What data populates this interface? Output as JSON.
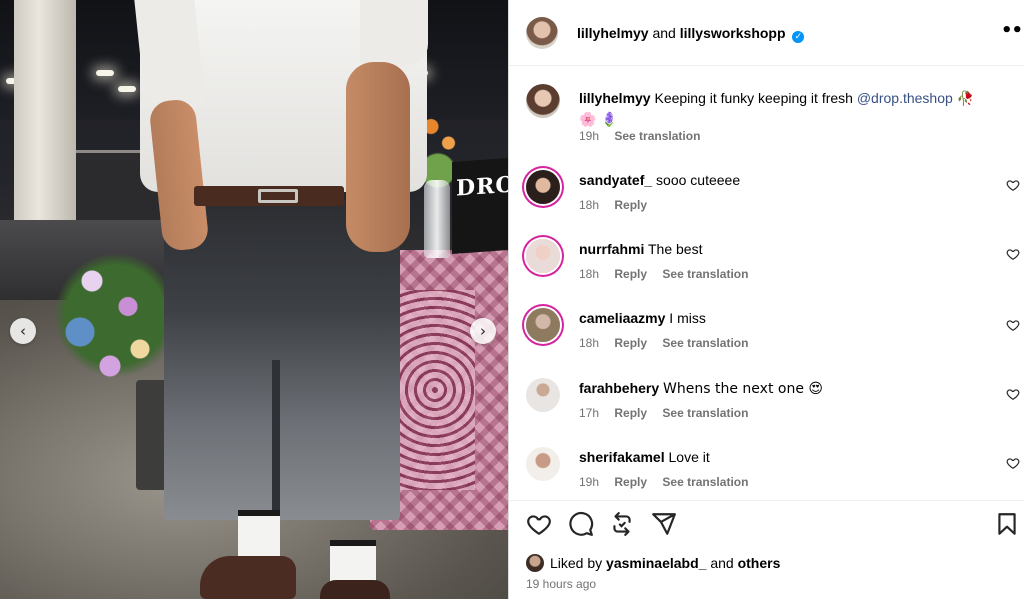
{
  "header": {
    "username": "lillyhelmyy",
    "joiner": "and",
    "collaborator": "lillysworkshopp",
    "verified_icon": "verified-badge-icon",
    "more_icon": "more-options-icon"
  },
  "photo": {
    "sign_text": "DROP",
    "prev_icon": "chevron-left-icon",
    "next_icon": "chevron-right-icon"
  },
  "caption": {
    "user": "lillyhelmyy",
    "text": "Keeping it funky keeping it fresh",
    "mention": "@drop.theshop",
    "emojis_line1": "🥀",
    "emojis_line2": "🌸 🪻",
    "time": "19h",
    "translate": "See translation"
  },
  "comments": [
    {
      "user": "sandyatef_",
      "text": "sooo cuteeee",
      "time": "18h",
      "reply": "Reply",
      "translate": ""
    },
    {
      "user": "nurrfahmi",
      "text": "The best",
      "time": "18h",
      "reply": "Reply",
      "translate": "See translation"
    },
    {
      "user": "cameliaazmy",
      "text": "I miss",
      "time": "18h",
      "reply": "Reply",
      "translate": "See translation"
    },
    {
      "user": "farahbehery",
      "text": "Whens the next one 😍",
      "time": "17h",
      "reply": "Reply",
      "translate": "See translation"
    },
    {
      "user": "sherifakamel",
      "text": "Love it",
      "time": "19h",
      "reply": "Reply",
      "translate": "See translation"
    }
  ],
  "actions": {
    "like_icon": "heart-icon",
    "comment_icon": "comment-icon",
    "repost_icon": "repost-icon",
    "share_icon": "share-icon",
    "save_icon": "bookmark-icon"
  },
  "likes": {
    "prefix": "Liked by",
    "user": "yasminaelabd_",
    "joiner": "and",
    "others": "others"
  },
  "posted_ago": "19 hours ago",
  "colors": {
    "link": "#385185",
    "verified": "#0095f6",
    "muted": "#737373",
    "story_ring": "#d6249f"
  }
}
